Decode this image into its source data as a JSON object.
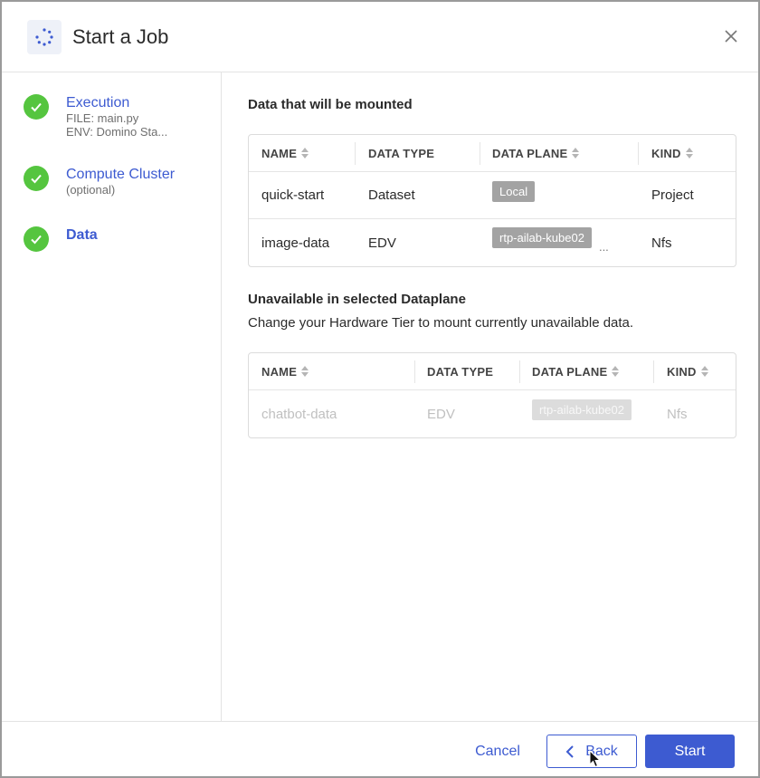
{
  "dialog": {
    "title": "Start a Job",
    "icon": "spinner-icon",
    "close_icon": "close-icon"
  },
  "steps": [
    {
      "title": "Execution",
      "lines": [
        "FILE: main.py",
        "ENV: Domino Sta..."
      ],
      "status": "complete"
    },
    {
      "title": "Compute Cluster",
      "lines": [
        "(optional)"
      ],
      "status": "complete"
    },
    {
      "title": "Data",
      "lines": [],
      "status": "complete",
      "active": true
    }
  ],
  "mounted": {
    "title": "Data that will be mounted",
    "columns": [
      "NAME",
      "DATA TYPE",
      "DATA PLANE",
      "KIND"
    ],
    "rows": [
      {
        "name": "quick-start",
        "type": "Dataset",
        "plane": "Local",
        "plane_more": "",
        "kind": "Project"
      },
      {
        "name": "image-data",
        "type": "EDV",
        "plane": "rtp-ailab-kube02",
        "plane_more": "...",
        "kind": "Nfs"
      }
    ]
  },
  "unavailable": {
    "title": "Unavailable in selected Dataplane",
    "description": "Change your Hardware Tier to mount currently unavailable data.",
    "columns": [
      "NAME",
      "DATA TYPE",
      "DATA PLANE",
      "KIND"
    ],
    "rows": [
      {
        "name": "chatbot-data",
        "type": "EDV",
        "plane": "rtp-ailab-kube02",
        "kind": "Nfs"
      }
    ]
  },
  "footer": {
    "cancel_label": "Cancel",
    "back_label": "Back",
    "start_label": "Start"
  },
  "colors": {
    "accent": "#3d5bd1",
    "success": "#55c53f",
    "tag": "#a3a3a3"
  }
}
